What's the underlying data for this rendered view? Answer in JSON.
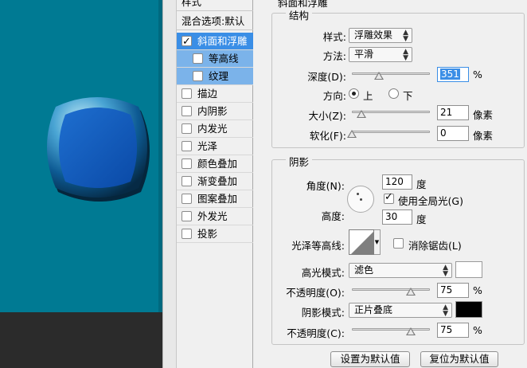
{
  "colors": {
    "canvas_bg": "#007a93",
    "selection": "#3a8ee6",
    "highlight_color": "#ffffff",
    "shadow_color": "#000000"
  },
  "style_list": {
    "header": "样式",
    "blend_options": "混合选项:默认",
    "items": [
      {
        "label": "斜面和浮雕",
        "checked": true,
        "selected": true
      },
      {
        "label": "等高线",
        "checked": false,
        "sub": true
      },
      {
        "label": "纹理",
        "checked": false,
        "sub": true
      },
      {
        "label": "描边",
        "checked": false
      },
      {
        "label": "内阴影",
        "checked": false
      },
      {
        "label": "内发光",
        "checked": false
      },
      {
        "label": "光泽",
        "checked": false
      },
      {
        "label": "颜色叠加",
        "checked": false
      },
      {
        "label": "渐变叠加",
        "checked": false
      },
      {
        "label": "图案叠加",
        "checked": false
      },
      {
        "label": "外发光",
        "checked": false
      },
      {
        "label": "投影",
        "checked": false
      }
    ]
  },
  "bevel": {
    "panel_title": "斜面和浮雕",
    "structure": {
      "title": "结构",
      "style_label": "样式:",
      "style_value": "浮雕效果",
      "technique_label": "方法:",
      "technique_value": "平滑",
      "depth_label": "深度(D):",
      "depth_value": "351",
      "depth_unit": "%",
      "depth_slider": 0.35,
      "direction_label": "方向:",
      "direction_up": "上",
      "direction_down": "下",
      "direction_selected": "上",
      "size_label": "大小(Z):",
      "size_value": "21",
      "size_unit": "像素",
      "size_slider": 0.12,
      "soften_label": "软化(F):",
      "soften_value": "0",
      "soften_unit": "像素",
      "soften_slider": 0.0
    },
    "shading": {
      "title": "阴影",
      "angle_label": "角度(N):",
      "angle_value": "120",
      "angle_unit": "度",
      "global_light_label": "使用全局光(G)",
      "global_light_checked": true,
      "altitude_label": "高度:",
      "altitude_value": "30",
      "altitude_unit": "度",
      "gloss_contour_label": "光泽等高线:",
      "anti_alias_label": "消除锯齿(L)",
      "anti_alias_checked": false,
      "highlight_mode_label": "高光模式:",
      "highlight_mode_value": "滤色",
      "highlight_opacity_label": "不透明度(O):",
      "highlight_opacity_value": "75",
      "highlight_opacity_unit": "%",
      "highlight_opacity_slider": 0.75,
      "shadow_mode_label": "阴影模式:",
      "shadow_mode_value": "正片叠底",
      "shadow_opacity_label": "不透明度(C):",
      "shadow_opacity_value": "75",
      "shadow_opacity_unit": "%",
      "shadow_opacity_slider": 0.75
    },
    "buttons": {
      "make_default": "设置为默认值",
      "reset_default": "复位为默认值"
    }
  }
}
